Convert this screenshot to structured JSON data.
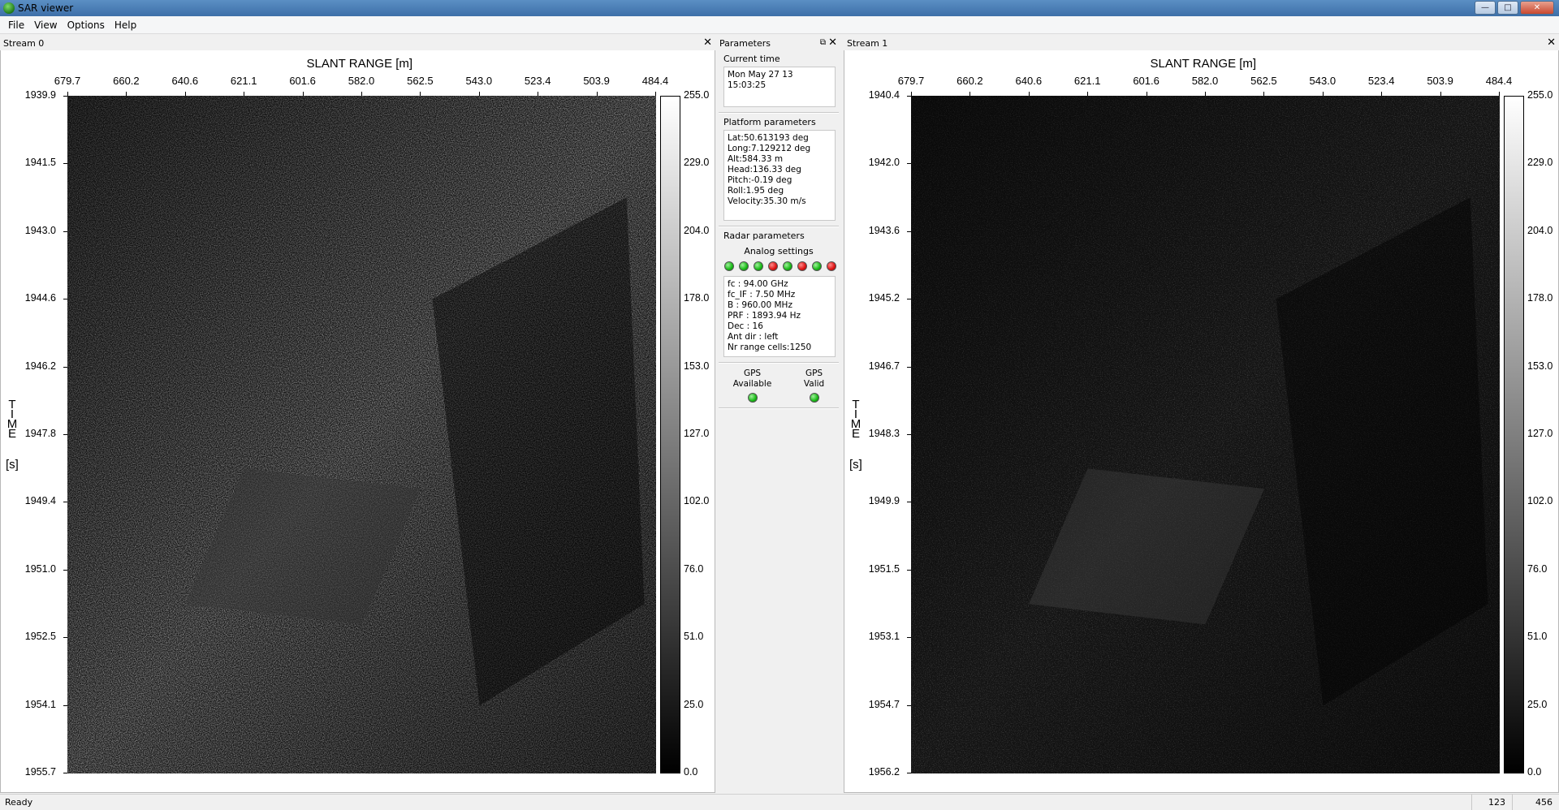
{
  "window": {
    "title": "SAR viewer",
    "icon": "sar-app-icon"
  },
  "menu": {
    "items": [
      "File",
      "View",
      "Options",
      "Help"
    ]
  },
  "stream0": {
    "title": "Stream 0",
    "x_axis_label": "SLANT RANGE [m]",
    "x_ticks": [
      "679.7",
      "660.2",
      "640.6",
      "621.1",
      "601.6",
      "582.0",
      "562.5",
      "543.0",
      "523.4",
      "503.9",
      "484.4"
    ],
    "y_axis_label": "TIME",
    "y_unit": "[s]",
    "y_ticks": [
      "1939.9",
      "1941.5",
      "1943.0",
      "1944.6",
      "1946.2",
      "1947.8",
      "1949.4",
      "1951.0",
      "1952.5",
      "1954.1",
      "1955.7"
    ],
    "colorbar_ticks": [
      "255.0",
      "229.0",
      "204.0",
      "178.0",
      "153.0",
      "127.0",
      "102.0",
      "76.0",
      "51.0",
      "25.0",
      "0.0"
    ]
  },
  "stream1": {
    "title": "Stream 1",
    "x_axis_label": "SLANT RANGE [m]",
    "x_ticks": [
      "679.7",
      "660.2",
      "640.6",
      "621.1",
      "601.6",
      "582.0",
      "562.5",
      "543.0",
      "523.4",
      "503.9",
      "484.4"
    ],
    "y_axis_label": "TIME",
    "y_unit": "[s]",
    "y_ticks": [
      "1940.4",
      "1942.0",
      "1943.6",
      "1945.2",
      "1946.7",
      "1948.3",
      "1949.9",
      "1951.5",
      "1953.1",
      "1954.7",
      "1956.2"
    ],
    "colorbar_ticks": [
      "255.0",
      "229.0",
      "204.0",
      "178.0",
      "153.0",
      "127.0",
      "102.0",
      "76.0",
      "51.0",
      "25.0",
      "0.0"
    ]
  },
  "parameters": {
    "title": "Parameters",
    "current_time_label": "Current time",
    "current_time_line1": "Mon May 27 13",
    "current_time_line2": "15:03:25",
    "platform_label": "Platform parameters",
    "platform_lines": [
      "Lat:50.613193 deg",
      "Long:7.129212 deg",
      "Alt:584.33 m",
      "Head:136.33 deg",
      "Pitch:-0.19 deg",
      "Roll:1.95 deg",
      "Velocity:35.30 m/s"
    ],
    "radar_label": "Radar parameters",
    "analog_label": "Analog settings",
    "analog_leds": [
      "green",
      "green",
      "green",
      "red",
      "green",
      "red",
      "green",
      "red"
    ],
    "radar_lines": [
      "fc : 94.00 GHz",
      "fc_IF : 7.50 MHz",
      "B : 960.00 MHz",
      "PRF : 1893.94 Hz",
      "Dec : 16",
      "Ant dir : left",
      "Nr range cells:1250"
    ],
    "gps_available_line1": "GPS",
    "gps_available_line2": "Available",
    "gps_valid_line1": "GPS",
    "gps_valid_line2": "Valid",
    "gps_available_status": "green",
    "gps_valid_status": "green"
  },
  "status": {
    "text": "Ready",
    "cell1": "123",
    "cell2": "456"
  }
}
